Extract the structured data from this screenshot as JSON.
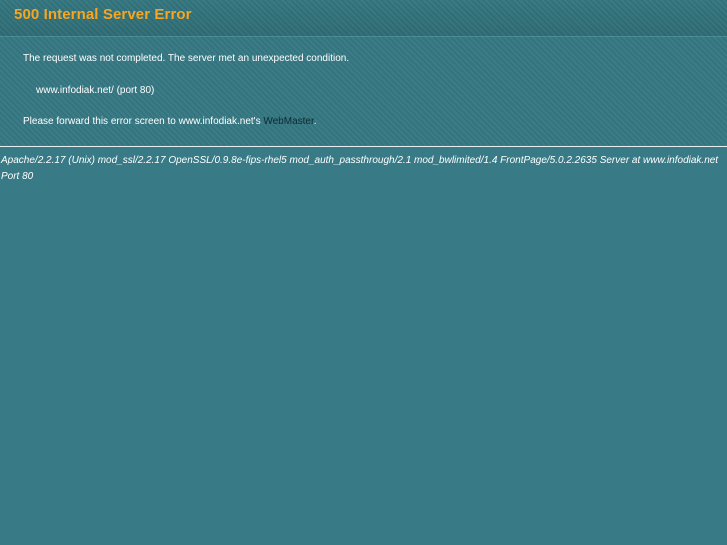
{
  "header": {
    "title": "500 Internal Server Error"
  },
  "main": {
    "message": "The request was not completed. The server met an unexpected condition.",
    "host_line": "www.infodiak.net/ (port 80)",
    "forward_prefix": "Please forward this error screen to www.infodiak.net's ",
    "webmaster_link": "WebMaster",
    "forward_suffix": "."
  },
  "footer": {
    "server_signature": "Apache/2.2.17 (Unix) mod_ssl/2.2.17 OpenSSL/0.9.8e-fips-rhel5 mod_auth_passthrough/2.1 mod_bwlimited/1.4 FrontPage/5.0.2.2635 Server at www.infodiak.net Port 80"
  },
  "colors": {
    "background": "#387b87",
    "title": "#f5a623",
    "text": "#ffffff",
    "link": "#0d2a30"
  }
}
